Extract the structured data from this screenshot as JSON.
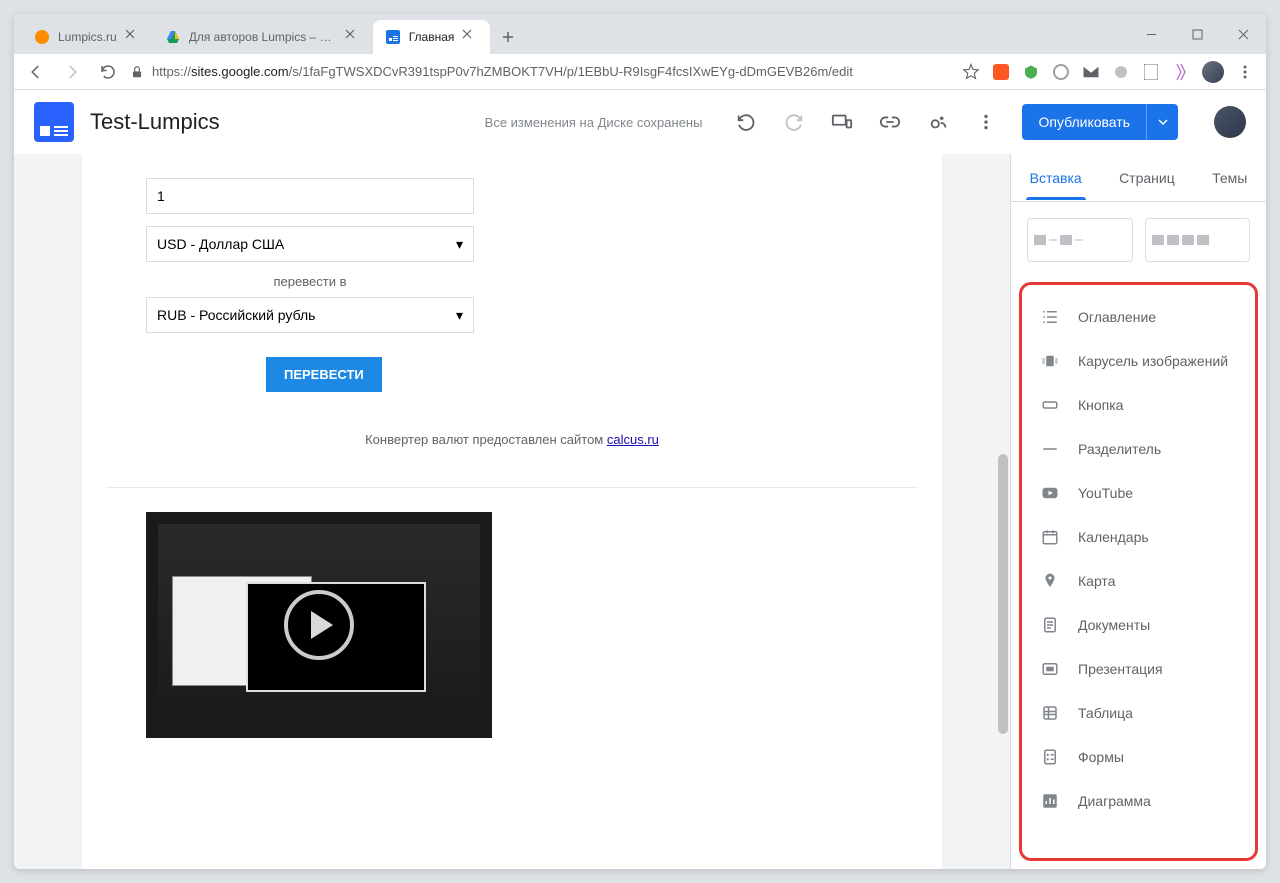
{
  "browser": {
    "tabs": [
      {
        "title": "Lumpics.ru",
        "favicon": "orange-circle"
      },
      {
        "title": "Для авторов Lumpics – Google Д",
        "favicon": "drive"
      },
      {
        "title": "Главная",
        "favicon": "sites"
      }
    ],
    "url_prefix": "https://",
    "url_host": "sites.google.com",
    "url_path": "/s/1faFgTWSXDCvR391tspP0v7hZMBOKT7VH/p/1EBbU-R9IsgF4fcsIXwEYg-dDmGEVB26m/edit"
  },
  "app": {
    "title": "Test-Lumpics",
    "save_status": "Все изменения на Диске сохранены",
    "publish": "Опубликовать"
  },
  "converter": {
    "amount": "1",
    "from_currency": "USD - Доллар США",
    "convert_to_label": "перевести в",
    "to_currency": "RUB - Российский рубль",
    "button": "ПЕРЕВЕСТИ",
    "credit_text": "Конвертер валют предоставлен сайтом ",
    "credit_link": "calcus.ru"
  },
  "panel": {
    "tabs": {
      "insert": "Вставка",
      "pages": "Страниц",
      "themes": "Темы"
    },
    "items": [
      {
        "label": "Оглавление",
        "icon": "toc"
      },
      {
        "label": "Карусель изображений",
        "icon": "carousel"
      },
      {
        "label": "Кнопка",
        "icon": "button"
      },
      {
        "label": "Разделитель",
        "icon": "divider"
      },
      {
        "label": "YouTube",
        "icon": "youtube"
      },
      {
        "label": "Календарь",
        "icon": "calendar"
      },
      {
        "label": "Карта",
        "icon": "map"
      },
      {
        "label": "Документы",
        "icon": "docs"
      },
      {
        "label": "Презентация",
        "icon": "slides"
      },
      {
        "label": "Таблица",
        "icon": "sheets"
      },
      {
        "label": "Формы",
        "icon": "forms"
      },
      {
        "label": "Диаграмма",
        "icon": "chart"
      }
    ]
  }
}
